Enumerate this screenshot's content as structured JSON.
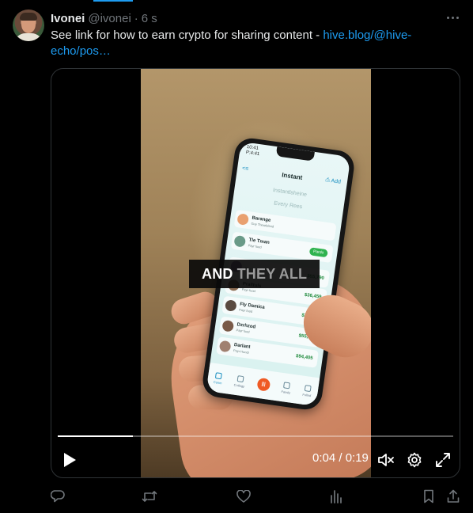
{
  "tweet": {
    "author_name": "Ivonei",
    "handle": "@ivonei",
    "separator": "·",
    "time": "6 s",
    "text": "See link for how to earn crypto for sharing content - ",
    "link_text": "hive.blog/@hive-echo/pos…"
  },
  "video": {
    "caption_white": "AND",
    "caption_gray": "THEY ALL",
    "current_time": "0:04",
    "duration": "0:19",
    "time_display": "0:04 / 0:19",
    "progress_fraction": 0.19
  },
  "phone_screen": {
    "status_time": "10:41",
    "status_sub": "P:4:41",
    "title": "Instant",
    "add_label": "Add",
    "back_label": "",
    "subtitle_1": "Instantlsheine",
    "subtitle_2": "Every Rees",
    "rows": [
      {
        "name": "Barange",
        "sub": "Guy Thewleland",
        "amount": "",
        "pill": "",
        "color": "#e9a070"
      },
      {
        "name": "Tle Tman",
        "sub": "Payr fuod",
        "amount": "",
        "pill": "Pardo",
        "color": "#6a9a88"
      },
      {
        "name": "",
        "sub": "Payr fuod",
        "amount": "$55,790",
        "pill": "",
        "color": "#7a6a9a"
      },
      {
        "name": "Pralltuls",
        "sub": "Payr fuod",
        "amount": "$36,459",
        "pill": "",
        "color": "#8a6a50"
      },
      {
        "name": "Fly Damica",
        "sub": "Payr fuod",
        "amount": "$25,409",
        "pill": "",
        "color": "#5a4a40"
      },
      {
        "name": "Dzrhzod",
        "sub": "Payr fuod",
        "amount": "$55,400",
        "pill": "",
        "color": "#7a5a48"
      },
      {
        "name": "Darlant",
        "sub": "Payr Hundi",
        "amount": "$94,405",
        "pill": "",
        "color": "#a08070"
      }
    ],
    "tabs": [
      "Conm",
      "Cutlogy",
      "",
      "Fansly",
      "Fullnd"
    ]
  },
  "icons": {
    "more": "more-horizontal-icon",
    "play": "play-icon",
    "mute": "volume-muted-icon",
    "settings": "gear-icon",
    "fullscreen": "fullscreen-icon",
    "reply": "reply-icon",
    "retweet": "retweet-icon",
    "like": "heart-icon",
    "views": "analytics-icon",
    "bookmark": "bookmark-icon",
    "share": "share-icon"
  },
  "colors": {
    "background": "#000000",
    "text": "#e7e9ea",
    "muted": "#71767b",
    "link": "#1d9bf0",
    "border": "#2f3336"
  }
}
